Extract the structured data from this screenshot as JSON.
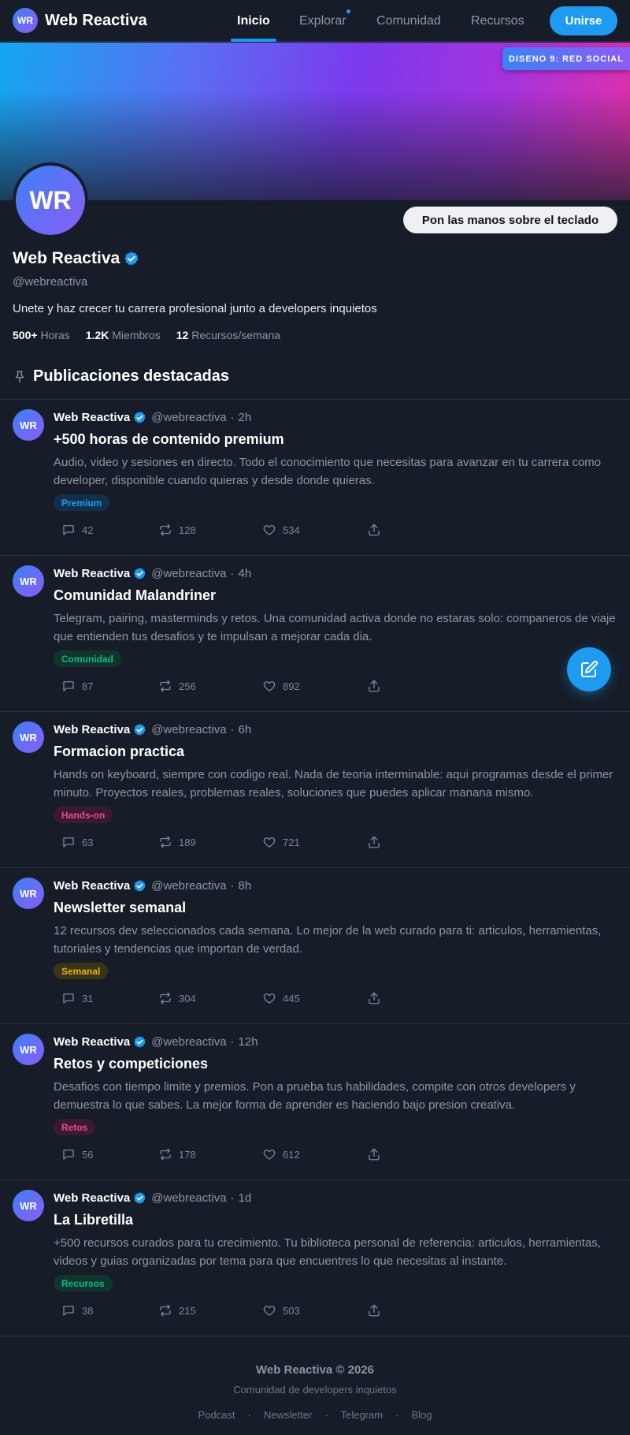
{
  "nav": {
    "brand_initials": "WR",
    "brand_name": "Web Reactiva",
    "links": [
      {
        "label": "Inicio",
        "active": true
      },
      {
        "label": "Explorar",
        "active": false
      },
      {
        "label": "Comunidad",
        "active": false
      },
      {
        "label": "Recursos",
        "active": false
      }
    ],
    "join_label": "Unirse"
  },
  "banner": {
    "design_badge": "DISENO 9: RED SOCIAL"
  },
  "profile": {
    "avatar_initials": "WR",
    "cta_label": "Pon las manos sobre el teclado",
    "name": "Web Reactiva",
    "handle": "@webreactiva",
    "bio": "Unete y haz crecer tu carrera profesional junto a developers inquietos",
    "stats": [
      {
        "value": "500+",
        "label": "Horas"
      },
      {
        "value": "1.2K",
        "label": "Miembros"
      },
      {
        "value": "12",
        "label": "Recursos/semana"
      }
    ]
  },
  "section": {
    "title": "Publicaciones destacadas",
    "icon": "pin-icon"
  },
  "posts": [
    {
      "author": "Web Reactiva",
      "handle": "@webreactiva",
      "time": "2h",
      "avatar": "WR",
      "title": "+500 horas de contenido premium",
      "body": "Audio, video y sesiones en directo. Todo el conocimiento que necesitas para avanzar en tu carrera como developer, disponible cuando quieras y desde donde quieras.",
      "tag": "Premium",
      "tag_color": "#1d9bf0",
      "tag_bg": "#143049",
      "replies": "42",
      "retweets": "128",
      "likes": "534"
    },
    {
      "author": "Web Reactiva",
      "handle": "@webreactiva",
      "time": "4h",
      "avatar": "WR",
      "title": "Comunidad Malandriner",
      "body": "Telegram, pairing, masterminds y retos. Una comunidad activa donde no estaras solo: companeros de viaje que entienden tus desafios y te impulsan a mejorar cada dia.",
      "tag": "Comunidad",
      "tag_color": "#10b981",
      "tag_bg": "#12342e",
      "replies": "87",
      "retweets": "256",
      "likes": "892"
    },
    {
      "author": "Web Reactiva",
      "handle": "@webreactiva",
      "time": "6h",
      "avatar": "WR",
      "title": "Formacion practica",
      "body": "Hands on keyboard, siempre con codigo real. Nada de teoria interminable: aqui programas desde el primer minuto. Proyectos reales, problemas reales, soluciones que puedes aplicar manana mismo.",
      "tag": "Hands-on",
      "tag_color": "#ec4899",
      "tag_bg": "#3a1a30",
      "replies": "63",
      "retweets": "189",
      "likes": "721"
    },
    {
      "author": "Web Reactiva",
      "handle": "@webreactiva",
      "time": "8h",
      "avatar": "WR",
      "title": "Newsletter semanal",
      "body": "12 recursos dev seleccionados cada semana. Lo mejor de la web curado para ti: articulos, herramientas, tutoriales y tendencias que importan de verdad.",
      "tag": "Semanal",
      "tag_color": "#eab308",
      "tag_bg": "#3a3416",
      "replies": "31",
      "retweets": "304",
      "likes": "445"
    },
    {
      "author": "Web Reactiva",
      "handle": "@webreactiva",
      "time": "12h",
      "avatar": "WR",
      "title": "Retos y competiciones",
      "body": "Desafios con tiempo limite y premios. Pon a prueba tus habilidades, compite con otros developers y demuestra lo que sabes. La mejor forma de aprender es haciendo bajo presion creativa.",
      "tag": "Retos",
      "tag_color": "#ec4899",
      "tag_bg": "#3a1a30",
      "replies": "56",
      "retweets": "178",
      "likes": "612"
    },
    {
      "author": "Web Reactiva",
      "handle": "@webreactiva",
      "time": "1d",
      "avatar": "WR",
      "title": "La Libretilla",
      "body": "+500 recursos curados para tu crecimiento. Tu biblioteca personal de referencia: articulos, herramientas, videos y guias organizadas por tema para que encuentres lo que necesitas al instante.",
      "tag": "Recursos",
      "tag_color": "#10b981",
      "tag_bg": "#12342e",
      "replies": "38",
      "retweets": "215",
      "likes": "503"
    }
  ],
  "fab": {
    "icon": "compose-icon"
  },
  "footer": {
    "title": "Web Reactiva © 2026",
    "subtitle": "Comunidad de developers inquietos",
    "links": [
      "Podcast",
      "Newsletter",
      "Telegram",
      "Blog"
    ],
    "separator": "·"
  },
  "colors": {
    "accent": "#1d9bf0",
    "background": "#161d29",
    "border": "#2a3342",
    "muted_text": "#8b96a6"
  }
}
